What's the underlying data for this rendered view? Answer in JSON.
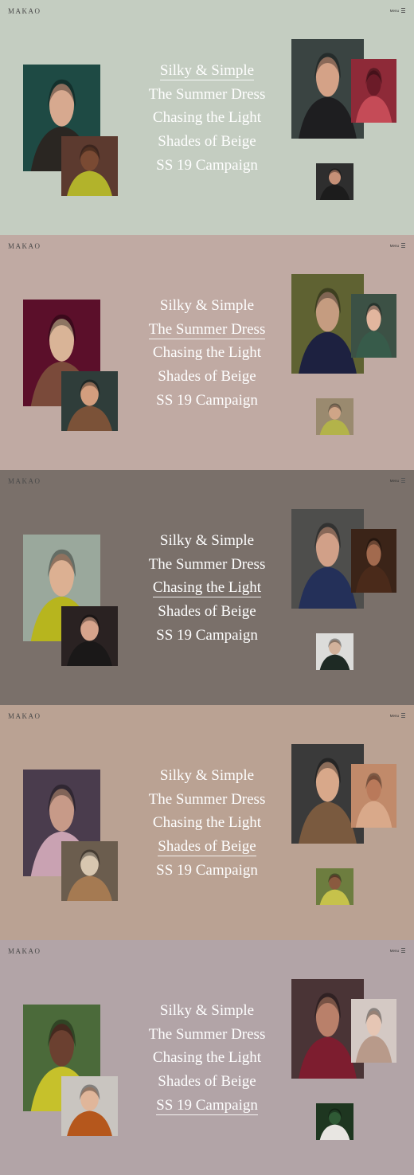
{
  "brand": "MAKAO",
  "menu_label": "Menu",
  "menu_icon": "hamburger-icon",
  "titles": [
    "Silky & Simple",
    "The Summer Dress",
    "Chasing the Light",
    "Shades of Beige",
    "SS 19 Campaign"
  ],
  "panels": [
    {
      "bg": "#c4cdc1",
      "active_index": 0,
      "images": {
        "left_large": {
          "bg": "#1e4a44",
          "fg": "#2a2622",
          "skin": "#d7a98f"
        },
        "left_small": {
          "bg": "#5c3a2f",
          "fg": "#b2b32b",
          "skin": "#7a4a33"
        },
        "right_large": {
          "bg": "#3a4442",
          "fg": "#1e1e20",
          "skin": "#d4a287"
        },
        "right_accent": {
          "bg": "#8e2a38",
          "fg": "#c54b57",
          "skin": "#6b1b28"
        },
        "right_small": {
          "bg": "#2e2e2e",
          "fg": "#1c1c1c",
          "skin": "#c59077"
        }
      }
    },
    {
      "bg": "#c0aaa3",
      "active_index": 1,
      "images": {
        "left_large": {
          "bg": "#5b0f2a",
          "fg": "#7a4a3a",
          "skin": "#d9b497"
        },
        "left_small": {
          "bg": "#2f3d3a",
          "fg": "#7b5238",
          "skin": "#d39e7e"
        },
        "right_large": {
          "bg": "#5f6232",
          "fg": "#1d2140",
          "skin": "#c59c80"
        },
        "right_accent": {
          "bg": "#3c5145",
          "fg": "#375b4a",
          "skin": "#e2b69e"
        },
        "right_small": {
          "bg": "#9a8a6f",
          "fg": "#b3b34a",
          "skin": "#cfa587"
        }
      }
    },
    {
      "bg": "#7a706a",
      "active_index": 2,
      "images": {
        "left_large": {
          "bg": "#9aa89c",
          "fg": "#b7b51e",
          "skin": "#dcb092"
        },
        "left_small": {
          "bg": "#2a2222",
          "fg": "#1a1818",
          "skin": "#d6a48c"
        },
        "right_large": {
          "bg": "#4e4e4c",
          "fg": "#243059",
          "skin": "#d1a088"
        },
        "right_accent": {
          "bg": "#3b2418",
          "fg": "#4a2a1a",
          "skin": "#a26a4e"
        },
        "right_small": {
          "bg": "#dcdcda",
          "fg": "#1e2a24",
          "skin": "#d2b29b"
        }
      }
    },
    {
      "bg": "#baa293",
      "active_index": 3,
      "images": {
        "left_large": {
          "bg": "#4a3c4d",
          "fg": "#c9a2b2",
          "skin": "#c79a88"
        },
        "left_small": {
          "bg": "#6b5d4e",
          "fg": "#a57a52",
          "skin": "#d8c7b0"
        },
        "right_large": {
          "bg": "#3a3a3a",
          "fg": "#7a5a3f",
          "skin": "#d8a88a"
        },
        "right_accent": {
          "bg": "#c18a6a",
          "fg": "#d9a98a",
          "skin": "#b9795a"
        },
        "right_small": {
          "bg": "#6d7d3f",
          "fg": "#c6c24b",
          "skin": "#8a5a3f"
        }
      }
    },
    {
      "bg": "#b2a4a7",
      "active_index": 4,
      "images": {
        "left_large": {
          "bg": "#4b6a3a",
          "fg": "#c6c12b",
          "skin": "#6b4030"
        },
        "left_small": {
          "bg": "#c9c5c0",
          "fg": "#b5571c",
          "skin": "#e0b69a"
        },
        "right_large": {
          "bg": "#4a3436",
          "fg": "#7d1d2f",
          "skin": "#b9806a"
        },
        "right_accent": {
          "bg": "#d4c9c4",
          "fg": "#b89a8a",
          "skin": "#e6c6b4"
        },
        "right_small": {
          "bg": "#1e3620",
          "fg": "#e8e6e2",
          "skin": "#2f5a35"
        }
      }
    }
  ]
}
